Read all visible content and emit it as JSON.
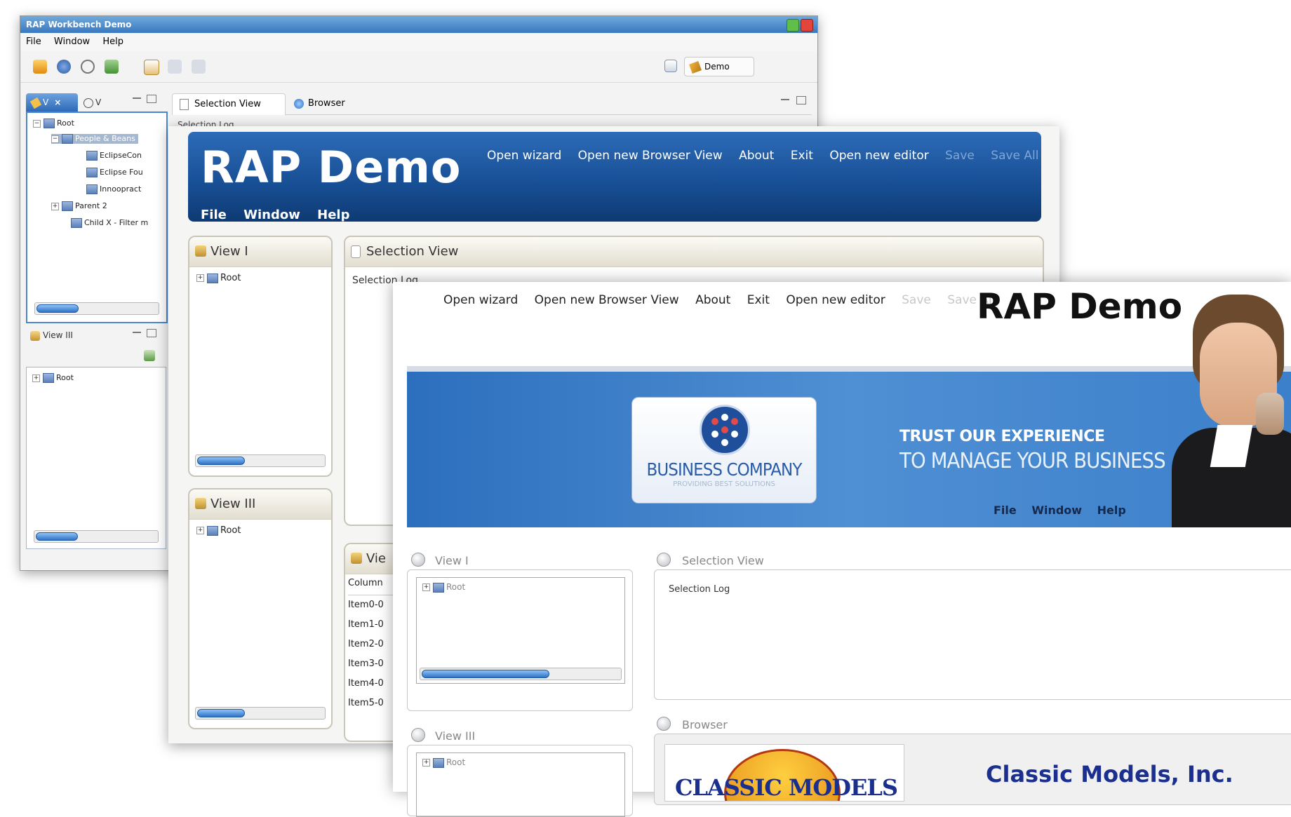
{
  "win1": {
    "title": "RAP Workbench Demo",
    "menu": [
      "File",
      "Window",
      "Help"
    ],
    "perspective_label": "Demo",
    "view_tabs": [
      "Selection View",
      "Browser"
    ],
    "view1_tab_short": "V",
    "view2_tab_short": "V",
    "view3_label": "View III",
    "selection_log_partial": "Selection Log",
    "tree1": {
      "root": "Root",
      "selected": "People & Beans",
      "children": [
        "EclipseCon",
        "Eclipse Fou",
        "Innoopract"
      ],
      "parent2": "Parent 2",
      "child_x": "Child X - Filter m"
    },
    "tree2_root": "Root"
  },
  "win2": {
    "brand": "RAP Demo",
    "actions": [
      "Open wizard",
      "Open new Browser View",
      "About",
      "Exit",
      "Open new editor"
    ],
    "actions_disabled": [
      "Save",
      "Save All"
    ],
    "menu": [
      "File",
      "Window",
      "Help"
    ],
    "view1_title": "View I",
    "view3_title": "View III",
    "selection_title": "Selection View",
    "selection_log_partial": "Selection Log",
    "view_partial_title": "Vie",
    "table_header": "Column",
    "table_items": [
      "Item0-0",
      "Item1-0",
      "Item2-0",
      "Item3-0",
      "Item4-0",
      "Item5-0"
    ],
    "tree_root": "Root"
  },
  "win3": {
    "actions": [
      "Open wizard",
      "Open new Browser View",
      "About",
      "Exit",
      "Open new editor"
    ],
    "actions_disabled": [
      "Save",
      "Save All"
    ],
    "brand": "RAP Demo",
    "logo_name": "BUSINESS COMPANY",
    "logo_tagline": "PROVIDING BEST SOLUTIONS",
    "slogan1": "TRUST OUR EXPERIENCE",
    "slogan2": "TO MANAGE YOUR BUSINESS",
    "menu": [
      "File",
      "Window",
      "Help"
    ],
    "view1_title": "View I",
    "view3_title": "View III",
    "selection_title": "Selection View",
    "selection_log": "Selection Log",
    "browser_title": "Browser",
    "classic_logo": "CLASSIC MODELS",
    "classic_heading": "Classic Models, Inc.",
    "tree_root": "Root"
  },
  "colors": {
    "rap_header_blue": "#1a5299",
    "banner_blue": "#3c80cb",
    "classic_heading": "#1b2f8f"
  }
}
